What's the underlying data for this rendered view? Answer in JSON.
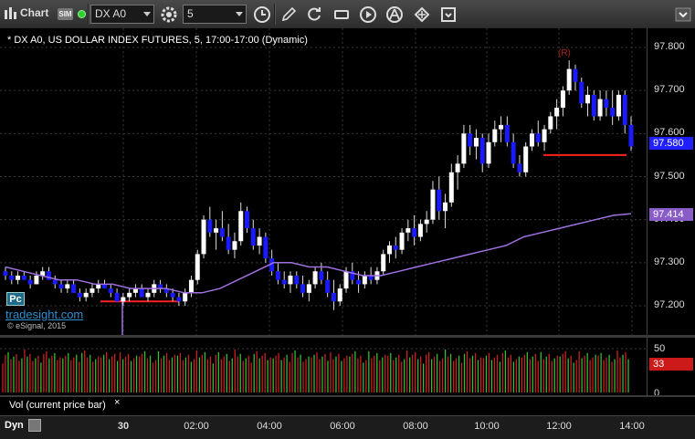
{
  "toolbar": {
    "chart_label": "Chart",
    "sim_badge": "SIM",
    "symbol": "DX A0",
    "interval": "5",
    "icons": [
      "chart-window-icon",
      "link-dot-icon",
      "symbol-dropdown-icon",
      "settings-gear-icon",
      "interval-dropdown-icon",
      "clock-icon",
      "pencil-icon",
      "refresh-icon",
      "cursor-icon",
      "play-icon",
      "alert-icon",
      "grid-icon",
      "scroll-icon"
    ]
  },
  "chart": {
    "title": "* DX A0, US DOLLAR INDEX FUTURES, 5, 17:00-17:00 (Dynamic)",
    "brand": "tradesight.com",
    "copyright": "© eSignal, 2015",
    "logo": "Pc",
    "r_label": "(R)",
    "last_price_tag": "97.580",
    "ma_tag": "97.414",
    "price_axis": [
      "97.800",
      "97.700",
      "97.600",
      "97.500",
      "97.400",
      "97.300",
      "97.200"
    ],
    "colors": {
      "up": "#ffffff",
      "down": "#1a1aff",
      "ma": "#a070e0",
      "support": "#ff2020",
      "counter": "#22aa22",
      "vol_red": "#cc2020",
      "vol_green": "#30c030"
    }
  },
  "volume": {
    "tab_label": "Vol (current price bar)",
    "tab_close": "×",
    "axis": [
      "50",
      "0"
    ],
    "last_tag": "33"
  },
  "bottom": {
    "dyn_label": "Dyn",
    "time_labels": [
      "30",
      "02:00",
      "04:00",
      "06:00",
      "08:00",
      "10:00",
      "12:00",
      "14:00"
    ]
  },
  "chart_data": {
    "type": "candlestick",
    "title": "* DX A0, US DOLLAR INDEX FUTURES, 5, 17:00-17:00 (Dynamic)",
    "ylim": [
      97.15,
      97.85
    ],
    "ohlc": [
      [
        97.28,
        97.29,
        97.26,
        97.27
      ],
      [
        97.27,
        97.28,
        97.25,
        97.26
      ],
      [
        97.26,
        97.28,
        97.25,
        97.27
      ],
      [
        97.27,
        97.28,
        97.26,
        97.26
      ],
      [
        97.26,
        97.27,
        97.24,
        97.25
      ],
      [
        97.25,
        97.28,
        97.25,
        97.27
      ],
      [
        97.27,
        97.29,
        97.26,
        97.28
      ],
      [
        97.28,
        97.29,
        97.26,
        97.26
      ],
      [
        97.26,
        97.27,
        97.24,
        97.25
      ],
      [
        97.25,
        97.26,
        97.23,
        97.24
      ],
      [
        97.24,
        97.26,
        97.23,
        97.25
      ],
      [
        97.25,
        97.26,
        97.23,
        97.23
      ],
      [
        97.23,
        97.24,
        97.21,
        97.22
      ],
      [
        97.22,
        97.24,
        97.21,
        97.23
      ],
      [
        97.23,
        97.25,
        97.22,
        97.24
      ],
      [
        97.24,
        97.26,
        97.23,
        97.25
      ],
      [
        97.25,
        97.26,
        97.24,
        97.24
      ],
      [
        97.24,
        97.25,
        97.22,
        97.23
      ],
      [
        97.23,
        97.24,
        97.21,
        97.21
      ],
      [
        97.21,
        97.23,
        97.2,
        97.22
      ],
      [
        97.22,
        97.24,
        97.21,
        97.23
      ],
      [
        97.23,
        97.25,
        97.22,
        97.24
      ],
      [
        97.24,
        97.25,
        97.22,
        97.22
      ],
      [
        97.22,
        97.24,
        97.21,
        97.23
      ],
      [
        97.23,
        97.26,
        97.22,
        97.25
      ],
      [
        97.25,
        97.26,
        97.23,
        97.24
      ],
      [
        97.24,
        97.25,
        97.22,
        97.23
      ],
      [
        97.23,
        97.24,
        97.21,
        97.22
      ],
      [
        97.22,
        97.23,
        97.2,
        97.21
      ],
      [
        97.21,
        97.24,
        97.2,
        97.23
      ],
      [
        97.23,
        97.27,
        97.22,
        97.26
      ],
      [
        97.26,
        97.33,
        97.25,
        97.32
      ],
      [
        97.32,
        97.41,
        97.31,
        97.4
      ],
      [
        97.4,
        97.43,
        97.36,
        97.37
      ],
      [
        97.37,
        97.4,
        97.33,
        97.38
      ],
      [
        97.38,
        97.42,
        97.35,
        97.36
      ],
      [
        97.36,
        97.39,
        97.32,
        97.33
      ],
      [
        97.33,
        97.37,
        97.31,
        97.35
      ],
      [
        97.35,
        97.44,
        97.34,
        97.42
      ],
      [
        97.42,
        97.43,
        97.37,
        97.38
      ],
      [
        97.38,
        97.4,
        97.33,
        97.34
      ],
      [
        97.34,
        97.38,
        97.32,
        97.36
      ],
      [
        97.36,
        97.37,
        97.3,
        97.31
      ],
      [
        97.31,
        97.33,
        97.27,
        97.28
      ],
      [
        97.28,
        97.3,
        97.25,
        97.26
      ],
      [
        97.26,
        97.28,
        97.24,
        97.25
      ],
      [
        97.25,
        97.28,
        97.23,
        97.27
      ],
      [
        97.27,
        97.28,
        97.24,
        97.25
      ],
      [
        97.25,
        97.27,
        97.22,
        97.23
      ],
      [
        97.23,
        97.26,
        97.21,
        97.25
      ],
      [
        97.25,
        97.29,
        97.24,
        97.28
      ],
      [
        97.28,
        97.3,
        97.25,
        97.26
      ],
      [
        97.26,
        97.28,
        97.22,
        97.23
      ],
      [
        97.23,
        97.26,
        97.19,
        97.21
      ],
      [
        97.21,
        97.25,
        97.2,
        97.24
      ],
      [
        97.24,
        97.29,
        97.23,
        97.28
      ],
      [
        97.28,
        97.3,
        97.25,
        97.26
      ],
      [
        97.26,
        97.28,
        97.23,
        97.25
      ],
      [
        97.25,
        97.28,
        97.24,
        97.27
      ],
      [
        97.27,
        97.29,
        97.25,
        97.26
      ],
      [
        97.26,
        97.29,
        97.25,
        97.28
      ],
      [
        97.28,
        97.33,
        97.27,
        97.32
      ],
      [
        97.32,
        97.35,
        97.3,
        97.34
      ],
      [
        97.34,
        97.36,
        97.31,
        97.33
      ],
      [
        97.33,
        97.38,
        97.32,
        97.37
      ],
      [
        97.37,
        97.4,
        97.35,
        97.38
      ],
      [
        97.38,
        97.41,
        97.34,
        97.36
      ],
      [
        97.36,
        97.4,
        97.35,
        97.39
      ],
      [
        97.39,
        97.42,
        97.37,
        97.4
      ],
      [
        97.4,
        97.49,
        97.39,
        97.47
      ],
      [
        97.47,
        97.5,
        97.4,
        97.42
      ],
      [
        97.42,
        97.46,
        97.38,
        97.44
      ],
      [
        97.44,
        97.53,
        97.43,
        97.51
      ],
      [
        97.51,
        97.55,
        97.47,
        97.53
      ],
      [
        97.53,
        97.62,
        97.52,
        97.6
      ],
      [
        97.6,
        97.62,
        97.55,
        97.57
      ],
      [
        97.57,
        97.61,
        97.54,
        97.59
      ],
      [
        97.59,
        97.6,
        97.51,
        97.53
      ],
      [
        97.53,
        97.6,
        97.52,
        97.58
      ],
      [
        97.58,
        97.63,
        97.57,
        97.61
      ],
      [
        97.61,
        97.64,
        97.58,
        97.62
      ],
      [
        97.62,
        97.64,
        97.57,
        97.58
      ],
      [
        97.58,
        97.6,
        97.52,
        97.53
      ],
      [
        97.53,
        97.55,
        97.5,
        97.51
      ],
      [
        97.51,
        97.58,
        97.5,
        97.57
      ],
      [
        97.57,
        97.61,
        97.56,
        97.6
      ],
      [
        97.6,
        97.63,
        97.57,
        97.58
      ],
      [
        97.58,
        97.62,
        97.56,
        97.61
      ],
      [
        97.61,
        97.65,
        97.6,
        97.64
      ],
      [
        97.64,
        97.68,
        97.61,
        97.66
      ],
      [
        97.66,
        97.71,
        97.64,
        97.7
      ],
      [
        97.7,
        97.77,
        97.69,
        97.75
      ],
      [
        97.75,
        97.76,
        97.7,
        97.72
      ],
      [
        97.72,
        97.73,
        97.66,
        97.67
      ],
      [
        97.67,
        97.71,
        97.64,
        97.69
      ],
      [
        97.69,
        97.7,
        97.63,
        97.64
      ],
      [
        97.64,
        97.7,
        97.63,
        97.68
      ],
      [
        97.68,
        97.7,
        97.64,
        97.66
      ],
      [
        97.66,
        97.7,
        97.62,
        97.64
      ],
      [
        97.64,
        97.7,
        97.63,
        97.69
      ],
      [
        97.69,
        97.7,
        97.6,
        97.62
      ],
      [
        97.62,
        97.64,
        97.56,
        97.57
      ]
    ],
    "moving_average": [
      97.29,
      97.28,
      97.27,
      97.26,
      97.26,
      97.25,
      97.25,
      97.24,
      97.24,
      97.24,
      97.23,
      97.23,
      97.24,
      97.26,
      97.28,
      97.3,
      97.3,
      97.29,
      97.29,
      97.28,
      97.27,
      97.27,
      97.28,
      97.29,
      97.3,
      97.31,
      97.32,
      97.33,
      97.34,
      97.36,
      97.37,
      97.38,
      97.39,
      97.4,
      97.41,
      97.414
    ],
    "support_lines": [
      {
        "y": 97.21,
        "label": ""
      },
      {
        "y": 97.55,
        "label": ""
      }
    ],
    "volume_ylim": [
      0,
      55
    ]
  }
}
